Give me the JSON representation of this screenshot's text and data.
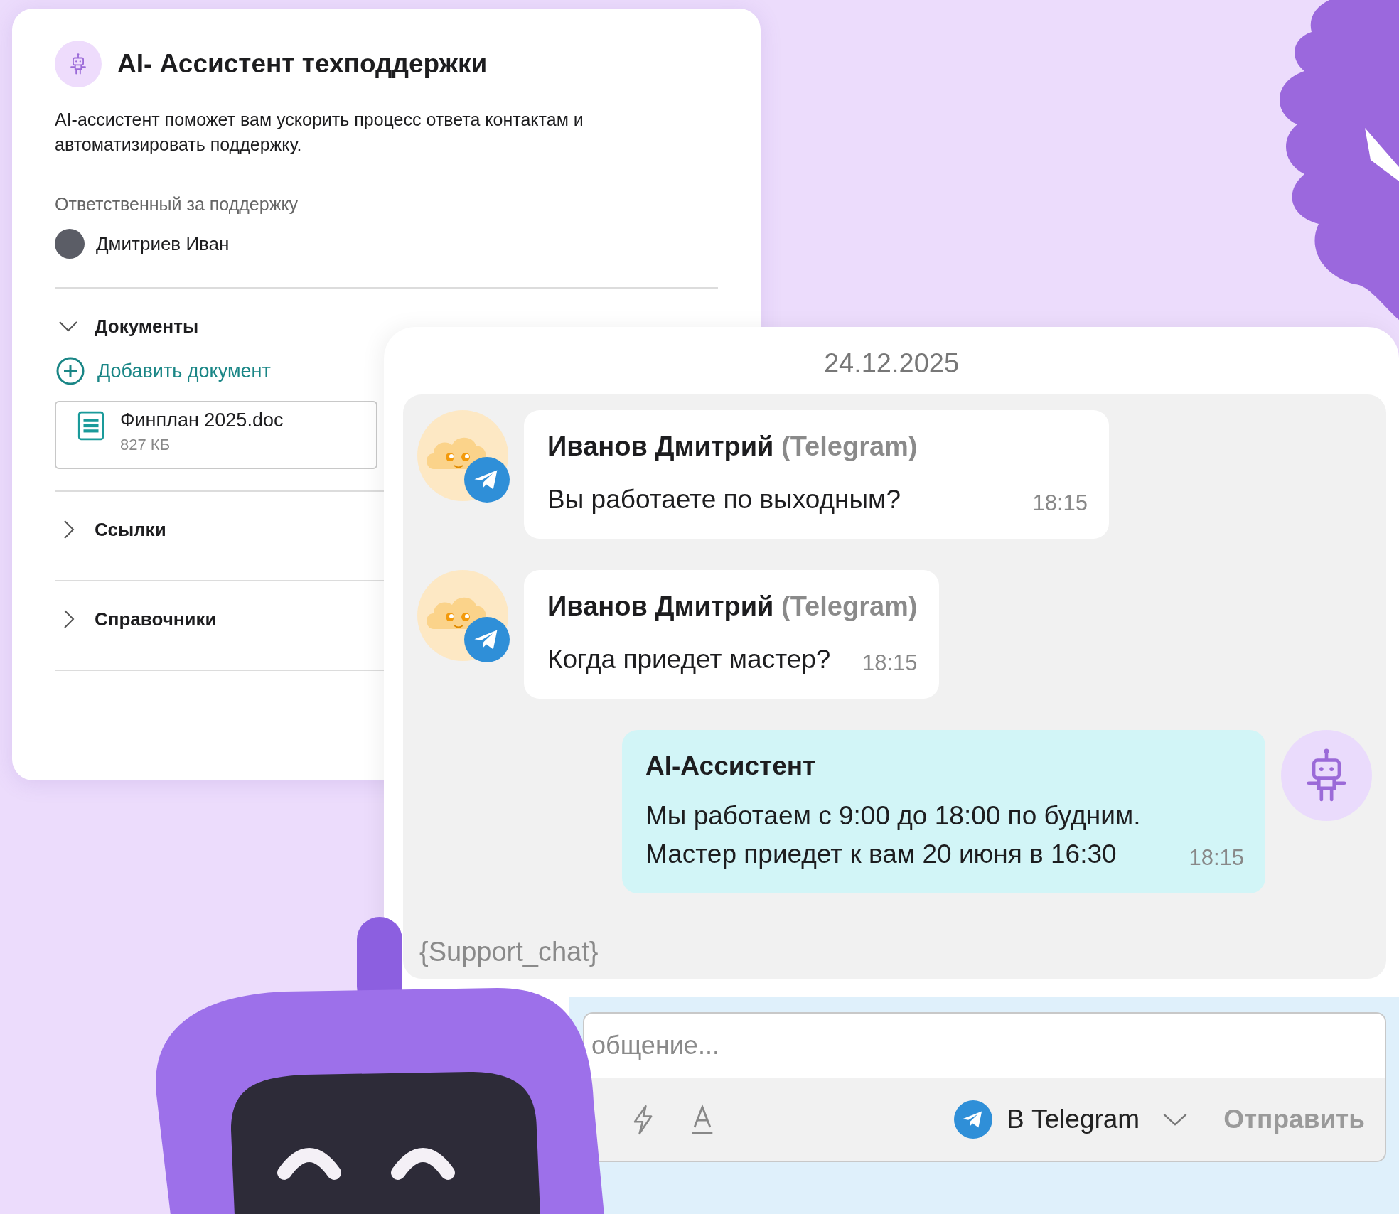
{
  "info_card": {
    "title": "AI- Ассистент техподдержки",
    "description": "AI-ассистент поможет вам ускорить процесс ответа контактам и автоматизировать поддержку.",
    "responsible_label": "Ответственный за поддержку",
    "responsible_name": "Дмитриев Иван",
    "sections": [
      {
        "title": "Документы",
        "expanded": true,
        "add_label": "Добавить документ",
        "files": [
          {
            "name": "Финплан 2025.doc",
            "size": "827 КБ"
          }
        ]
      },
      {
        "title": "Ссылки",
        "expanded": false
      },
      {
        "title": "Справочники",
        "expanded": false
      }
    ]
  },
  "chat": {
    "date": "24.12.2025",
    "messages": [
      {
        "kind": "incoming",
        "author": "Иванов Дмитрий",
        "channel": "(Telegram)",
        "text": "Вы работаете по выходным?",
        "time": "18:15"
      },
      {
        "kind": "incoming",
        "author": "Иванов Дмитрий",
        "channel": "(Telegram)",
        "text": "Когда приедет мастер?",
        "time": "18:15"
      },
      {
        "kind": "assistant",
        "author": "AI-Ассистент",
        "text": "Мы работаем с 9:00 до 18:00 по будним.\nМастер приедет к вам 20 июня в 16:30",
        "time": "18:15"
      }
    ],
    "footer_tag": "{Support_chat}",
    "composer": {
      "placeholder": "общение...",
      "channel": "В Telegram",
      "send": "Отправить"
    }
  }
}
